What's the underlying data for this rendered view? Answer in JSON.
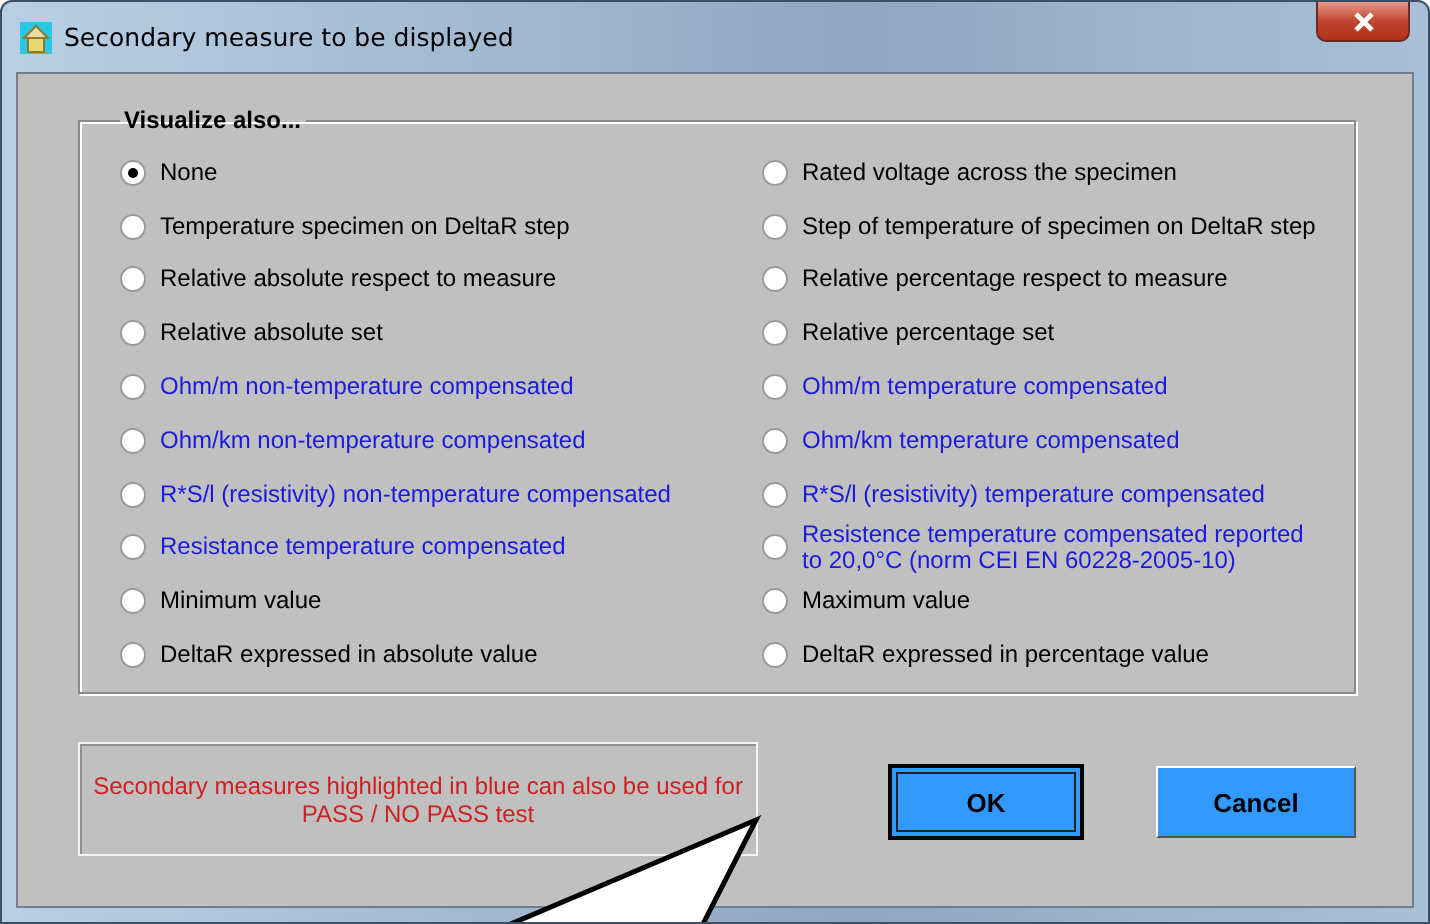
{
  "window": {
    "title": "Secondary measure to be displayed"
  },
  "group": {
    "title": "Visualize also...",
    "options": [
      {
        "label": "None",
        "selected": true,
        "highlighted": false
      },
      {
        "label": "Temperature specimen on DeltaR step",
        "selected": false,
        "highlighted": false
      },
      {
        "label": "Relative absolute respect to measure",
        "selected": false,
        "highlighted": false
      },
      {
        "label": "Relative absolute set",
        "selected": false,
        "highlighted": false
      },
      {
        "label": "Ohm/m non-temperature compensated",
        "selected": false,
        "highlighted": true
      },
      {
        "label": "Ohm/km non-temperature compensated",
        "selected": false,
        "highlighted": true
      },
      {
        "label": "R*S/l (resistivity) non-temperature compensated",
        "selected": false,
        "highlighted": true
      },
      {
        "label": "Resistance temperature compensated",
        "selected": false,
        "highlighted": true
      },
      {
        "label": "Minimum value",
        "selected": false,
        "highlighted": false
      },
      {
        "label": "DeltaR expressed in absolute value",
        "selected": false,
        "highlighted": false
      },
      {
        "label": "Rated voltage across the specimen",
        "selected": false,
        "highlighted": false
      },
      {
        "label": "Step of temperature of specimen on DeltaR step",
        "selected": false,
        "highlighted": false
      },
      {
        "label": "Relative percentage respect to measure",
        "selected": false,
        "highlighted": false
      },
      {
        "label": "Relative percentage set",
        "selected": false,
        "highlighted": false
      },
      {
        "label": "Ohm/m temperature compensated",
        "selected": false,
        "highlighted": true
      },
      {
        "label": "Ohm/km temperature compensated",
        "selected": false,
        "highlighted": true
      },
      {
        "label": "R*S/l (resistivity) temperature compensated",
        "selected": false,
        "highlighted": true
      },
      {
        "label": "Resistence temperature compensated reported to 20,0°C (norm CEI EN 60228-2005-10)",
        "selected": false,
        "highlighted": true
      },
      {
        "label": "Maximum value",
        "selected": false,
        "highlighted": false
      },
      {
        "label": "DeltaR expressed in percentage value",
        "selected": false,
        "highlighted": false
      }
    ]
  },
  "note": "Secondary measures highlighted in blue can also be used for PASS / NO PASS test",
  "buttons": [
    {
      "label": "OK",
      "focused": true
    },
    {
      "label": "Cancel",
      "focused": false
    }
  ]
}
